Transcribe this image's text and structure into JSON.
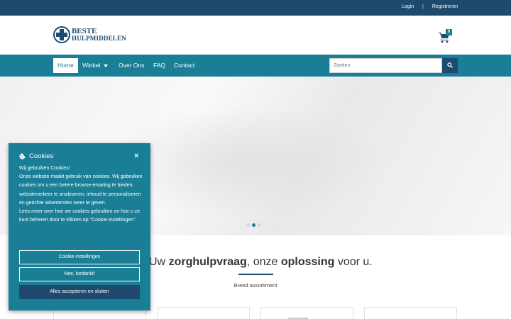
{
  "topbar": {
    "login": "Login",
    "separator": "|",
    "register": "Registreren"
  },
  "logo": {
    "line1": "BESTE",
    "line2": "HULPMIDDELEN",
    "icon": "medical-cross-icon"
  },
  "cart": {
    "count": "0",
    "icon": "cart-icon"
  },
  "nav": {
    "items": [
      {
        "label": "Home",
        "active": true
      },
      {
        "label": "Winkel",
        "dropdown": true
      },
      {
        "label": "Over Ons"
      },
      {
        "label": "FAQ"
      },
      {
        "label": "Contact"
      }
    ],
    "search_placeholder": "Zoeken",
    "search_icon": "search-icon"
  },
  "hero": {
    "active_slide": 2,
    "slides": 3
  },
  "tagline": {
    "pre": "Uw ",
    "bold1": "zorghulpvraag",
    "mid": ", onze ",
    "bold2": "oplossing",
    "post": " voor u."
  },
  "subheading": "Breed assortiment",
  "cookie_dialog": {
    "title": "Cookies",
    "icon": "cookie-icon",
    "close": "×",
    "lines": [
      "Wij gebruiken Cookies!",
      "Onze website maakt gebruik van cookies. Wij gebruiken cookies om u een betere browse-ervaring te bieden, websiteverkeer te analyseren, inhoud te personaliseren en gerichte advertenties weer te geven.",
      "Lees meer over hoe we cookies gebruiken en hoe u ze kunt beheren door te klikken op \"Cookie-instellingen\"."
    ],
    "buttons": {
      "settings": "Cookie instellingen",
      "decline": "Nee, bedankt!",
      "accept": "Alles accepteren en sluiten"
    }
  },
  "colors": {
    "primary": "#1a7f96",
    "dark": "#1e4a6e"
  }
}
